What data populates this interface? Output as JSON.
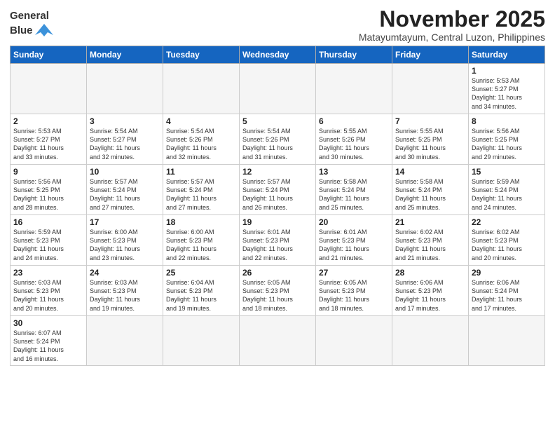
{
  "header": {
    "logo_line1": "General",
    "logo_line2": "Blue",
    "month_title": "November 2025",
    "location": "Matayumtayum, Central Luzon, Philippines"
  },
  "days_of_week": [
    "Sunday",
    "Monday",
    "Tuesday",
    "Wednesday",
    "Thursday",
    "Friday",
    "Saturday"
  ],
  "weeks": [
    [
      {
        "day": "",
        "info": ""
      },
      {
        "day": "",
        "info": ""
      },
      {
        "day": "",
        "info": ""
      },
      {
        "day": "",
        "info": ""
      },
      {
        "day": "",
        "info": ""
      },
      {
        "day": "",
        "info": ""
      },
      {
        "day": "1",
        "info": "Sunrise: 5:53 AM\nSunset: 5:27 PM\nDaylight: 11 hours\nand 34 minutes."
      }
    ],
    [
      {
        "day": "2",
        "info": "Sunrise: 5:53 AM\nSunset: 5:27 PM\nDaylight: 11 hours\nand 33 minutes."
      },
      {
        "day": "3",
        "info": "Sunrise: 5:54 AM\nSunset: 5:27 PM\nDaylight: 11 hours\nand 32 minutes."
      },
      {
        "day": "4",
        "info": "Sunrise: 5:54 AM\nSunset: 5:26 PM\nDaylight: 11 hours\nand 32 minutes."
      },
      {
        "day": "5",
        "info": "Sunrise: 5:54 AM\nSunset: 5:26 PM\nDaylight: 11 hours\nand 31 minutes."
      },
      {
        "day": "6",
        "info": "Sunrise: 5:55 AM\nSunset: 5:26 PM\nDaylight: 11 hours\nand 30 minutes."
      },
      {
        "day": "7",
        "info": "Sunrise: 5:55 AM\nSunset: 5:25 PM\nDaylight: 11 hours\nand 30 minutes."
      },
      {
        "day": "8",
        "info": "Sunrise: 5:56 AM\nSunset: 5:25 PM\nDaylight: 11 hours\nand 29 minutes."
      }
    ],
    [
      {
        "day": "9",
        "info": "Sunrise: 5:56 AM\nSunset: 5:25 PM\nDaylight: 11 hours\nand 28 minutes."
      },
      {
        "day": "10",
        "info": "Sunrise: 5:57 AM\nSunset: 5:24 PM\nDaylight: 11 hours\nand 27 minutes."
      },
      {
        "day": "11",
        "info": "Sunrise: 5:57 AM\nSunset: 5:24 PM\nDaylight: 11 hours\nand 27 minutes."
      },
      {
        "day": "12",
        "info": "Sunrise: 5:57 AM\nSunset: 5:24 PM\nDaylight: 11 hours\nand 26 minutes."
      },
      {
        "day": "13",
        "info": "Sunrise: 5:58 AM\nSunset: 5:24 PM\nDaylight: 11 hours\nand 25 minutes."
      },
      {
        "day": "14",
        "info": "Sunrise: 5:58 AM\nSunset: 5:24 PM\nDaylight: 11 hours\nand 25 minutes."
      },
      {
        "day": "15",
        "info": "Sunrise: 5:59 AM\nSunset: 5:24 PM\nDaylight: 11 hours\nand 24 minutes."
      }
    ],
    [
      {
        "day": "16",
        "info": "Sunrise: 5:59 AM\nSunset: 5:23 PM\nDaylight: 11 hours\nand 24 minutes."
      },
      {
        "day": "17",
        "info": "Sunrise: 6:00 AM\nSunset: 5:23 PM\nDaylight: 11 hours\nand 23 minutes."
      },
      {
        "day": "18",
        "info": "Sunrise: 6:00 AM\nSunset: 5:23 PM\nDaylight: 11 hours\nand 22 minutes."
      },
      {
        "day": "19",
        "info": "Sunrise: 6:01 AM\nSunset: 5:23 PM\nDaylight: 11 hours\nand 22 minutes."
      },
      {
        "day": "20",
        "info": "Sunrise: 6:01 AM\nSunset: 5:23 PM\nDaylight: 11 hours\nand 21 minutes."
      },
      {
        "day": "21",
        "info": "Sunrise: 6:02 AM\nSunset: 5:23 PM\nDaylight: 11 hours\nand 21 minutes."
      },
      {
        "day": "22",
        "info": "Sunrise: 6:02 AM\nSunset: 5:23 PM\nDaylight: 11 hours\nand 20 minutes."
      }
    ],
    [
      {
        "day": "23",
        "info": "Sunrise: 6:03 AM\nSunset: 5:23 PM\nDaylight: 11 hours\nand 20 minutes."
      },
      {
        "day": "24",
        "info": "Sunrise: 6:03 AM\nSunset: 5:23 PM\nDaylight: 11 hours\nand 19 minutes."
      },
      {
        "day": "25",
        "info": "Sunrise: 6:04 AM\nSunset: 5:23 PM\nDaylight: 11 hours\nand 19 minutes."
      },
      {
        "day": "26",
        "info": "Sunrise: 6:05 AM\nSunset: 5:23 PM\nDaylight: 11 hours\nand 18 minutes."
      },
      {
        "day": "27",
        "info": "Sunrise: 6:05 AM\nSunset: 5:23 PM\nDaylight: 11 hours\nand 18 minutes."
      },
      {
        "day": "28",
        "info": "Sunrise: 6:06 AM\nSunset: 5:23 PM\nDaylight: 11 hours\nand 17 minutes."
      },
      {
        "day": "29",
        "info": "Sunrise: 6:06 AM\nSunset: 5:24 PM\nDaylight: 11 hours\nand 17 minutes."
      }
    ],
    [
      {
        "day": "30",
        "info": "Sunrise: 6:07 AM\nSunset: 5:24 PM\nDaylight: 11 hours\nand 16 minutes."
      },
      {
        "day": "",
        "info": ""
      },
      {
        "day": "",
        "info": ""
      },
      {
        "day": "",
        "info": ""
      },
      {
        "day": "",
        "info": ""
      },
      {
        "day": "",
        "info": ""
      },
      {
        "day": "",
        "info": ""
      }
    ]
  ]
}
